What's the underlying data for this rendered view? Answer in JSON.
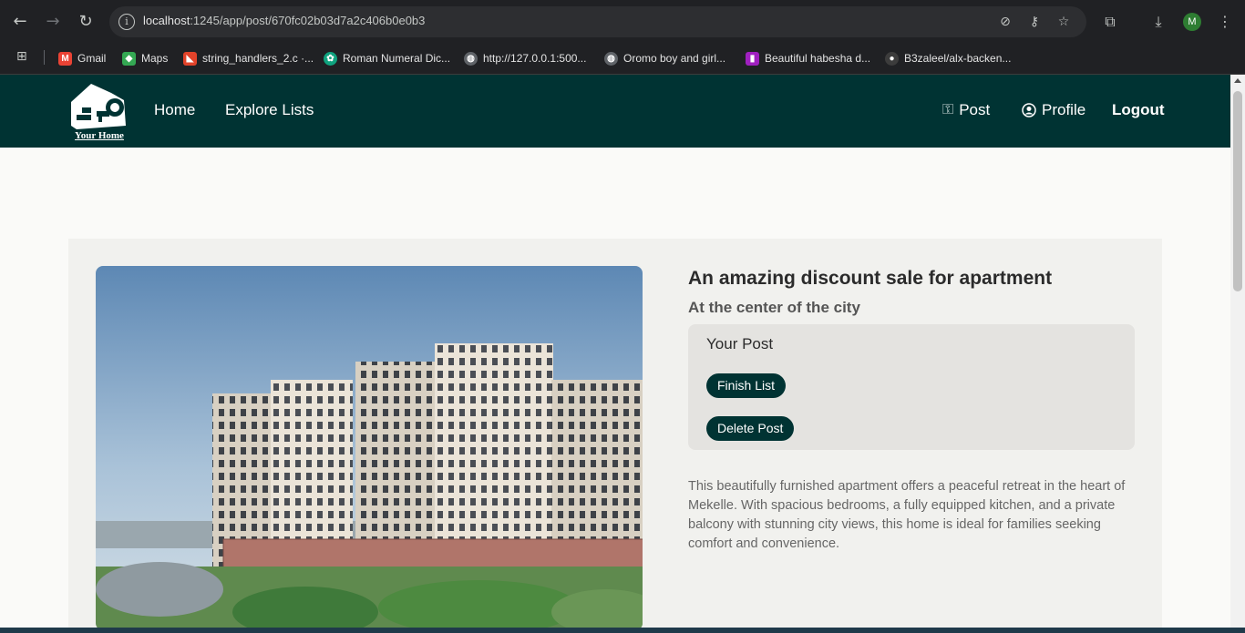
{
  "browser": {
    "url_host": "localhost",
    "url_rest": ":1245/app/post/670fc02b03d7a2c406b0e0b3",
    "profile_initial": "M",
    "bookmarks": [
      {
        "label": "Gmail",
        "icon": "gmail-icon"
      },
      {
        "label": "Maps",
        "icon": "maps-icon"
      },
      {
        "label": "string_handlers_2.c ·...",
        "icon": "gitlab-icon"
      },
      {
        "label": "Roman Numeral Dic...",
        "icon": "chatgpt-icon"
      },
      {
        "label": "http://127.0.0.1:500...",
        "icon": "globe-icon"
      },
      {
        "label": "Oromo boy and girl...",
        "icon": "globe-icon"
      },
      {
        "label": "Beautiful habesha d...",
        "icon": "bookmark-icon"
      },
      {
        "label": "B3zaleel/alx-backen...",
        "icon": "github-icon"
      }
    ]
  },
  "site": {
    "logo_text": "Your Home",
    "nav": {
      "home": "Home",
      "explore": "Explore Lists",
      "post": "Post",
      "profile": "Profile",
      "logout": "Logout"
    },
    "brand_color": "#003333"
  },
  "post": {
    "title": "An amazing discount sale for apartment",
    "subtitle": "At the center of the city",
    "owner_panel": {
      "heading": "Your Post",
      "finish_label": "Finish List",
      "delete_label": "Delete Post"
    },
    "description": "This beautifully furnished apartment offers a peaceful retreat in the heart of Mekelle. With spacious bedrooms, a fully equipped kitchen, and a private balcony with stunning city views, this home is ideal for families seeking comfort and convenience."
  }
}
